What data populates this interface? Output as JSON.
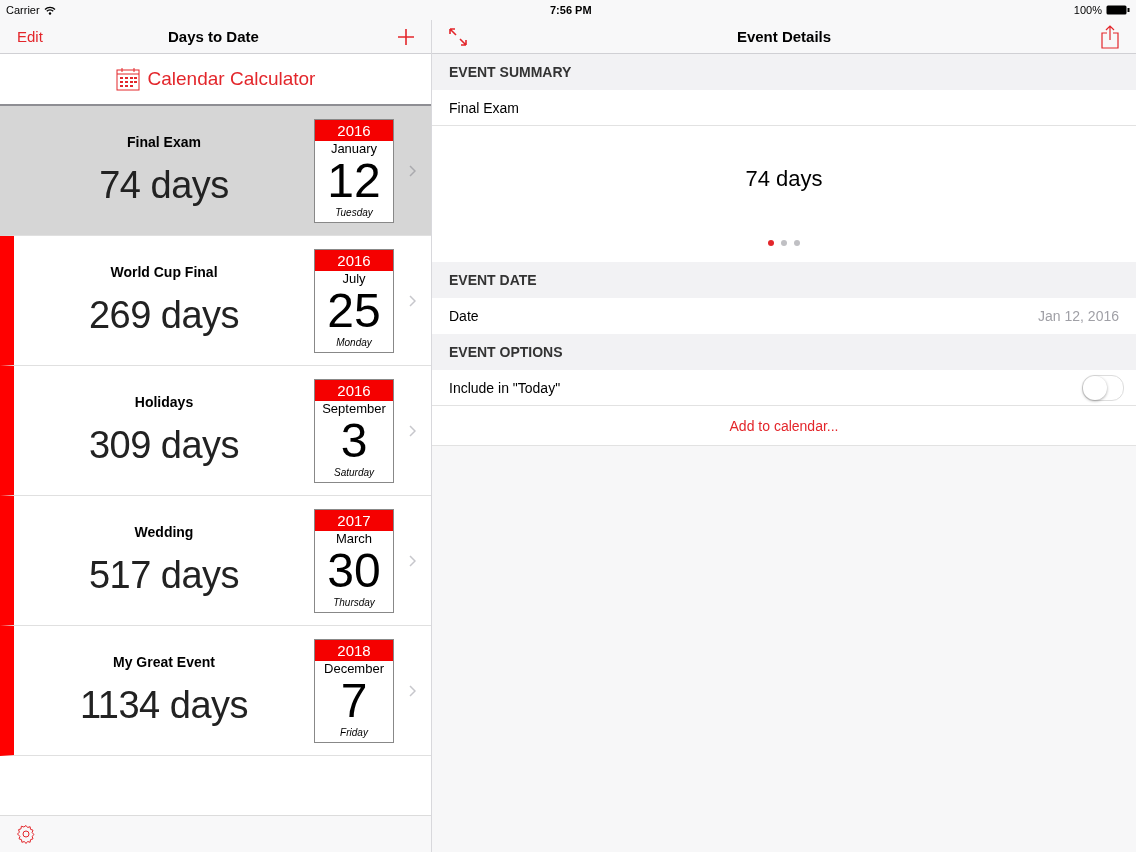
{
  "status_bar": {
    "carrier": "Carrier",
    "time": "7:56 PM",
    "battery": "100%"
  },
  "left": {
    "nav": {
      "left_button": "Edit",
      "title": "Days to Date"
    },
    "header_button": "Calendar Calculator",
    "events": [
      {
        "title": "Final Exam",
        "days": "74 days",
        "year": "2016",
        "month": "January",
        "day": "12",
        "weekday": "Tuesday",
        "selected": true
      },
      {
        "title": "World Cup Final",
        "days": "269 days",
        "year": "2016",
        "month": "July",
        "day": "25",
        "weekday": "Monday",
        "selected": false
      },
      {
        "title": "Holidays",
        "days": "309 days",
        "year": "2016",
        "month": "September",
        "day": "3",
        "weekday": "Saturday",
        "selected": false
      },
      {
        "title": "Wedding",
        "days": "517 days",
        "year": "2017",
        "month": "March",
        "day": "30",
        "weekday": "Thursday",
        "selected": false
      },
      {
        "title": "My Great Event",
        "days": "1134 days",
        "year": "2018",
        "month": "December",
        "day": "7",
        "weekday": "Friday",
        "selected": false
      }
    ]
  },
  "right": {
    "nav": {
      "title": "Event Details"
    },
    "summary": {
      "header": "EVENT SUMMARY",
      "name": "Final Exam",
      "days": "74 days",
      "pages": [
        {
          "selected": true
        },
        {
          "selected": false
        },
        {
          "selected": false
        }
      ]
    },
    "date": {
      "header": "EVENT DATE",
      "label": "Date",
      "value": "Jan 12, 2016"
    },
    "options": {
      "header": "EVENT OPTIONS",
      "include_label": "Include in \"Today\"",
      "include_on": false,
      "add_link": "Add to calendar..."
    }
  }
}
